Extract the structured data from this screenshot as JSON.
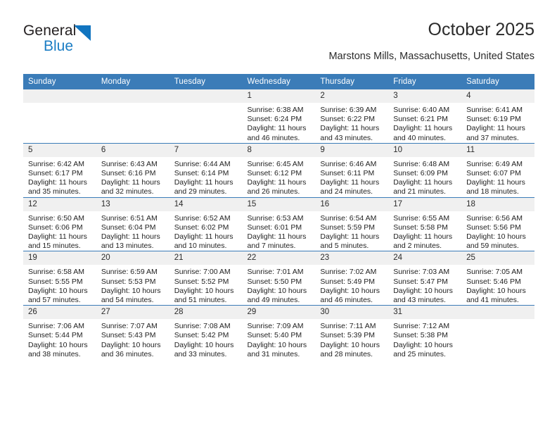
{
  "brand": {
    "name_top": "General",
    "name_bottom": "Blue",
    "accent_color": "#1b7dc4",
    "triangle_color": "#1175c0"
  },
  "header": {
    "title": "October 2025",
    "subtitle": "Marstons Mills, Massachusetts, United States",
    "header_bg": "#3b7cb8",
    "daynum_bg": "#f0f0f0"
  },
  "calendar": {
    "weekday_headers": [
      "Sunday",
      "Monday",
      "Tuesday",
      "Wednesday",
      "Thursday",
      "Friday",
      "Saturday"
    ],
    "weeks": [
      [
        {
          "day": "",
          "empty": true,
          "sunrise": "",
          "sunset": "",
          "daylight_line1": "",
          "daylight_line2": ""
        },
        {
          "day": "",
          "empty": true,
          "sunrise": "",
          "sunset": "",
          "daylight_line1": "",
          "daylight_line2": ""
        },
        {
          "day": "",
          "empty": true,
          "sunrise": "",
          "sunset": "",
          "daylight_line1": "",
          "daylight_line2": ""
        },
        {
          "day": "1",
          "empty": false,
          "sunrise": "Sunrise: 6:38 AM",
          "sunset": "Sunset: 6:24 PM",
          "daylight_line1": "Daylight: 11 hours",
          "daylight_line2": "and 46 minutes."
        },
        {
          "day": "2",
          "empty": false,
          "sunrise": "Sunrise: 6:39 AM",
          "sunset": "Sunset: 6:22 PM",
          "daylight_line1": "Daylight: 11 hours",
          "daylight_line2": "and 43 minutes."
        },
        {
          "day": "3",
          "empty": false,
          "sunrise": "Sunrise: 6:40 AM",
          "sunset": "Sunset: 6:21 PM",
          "daylight_line1": "Daylight: 11 hours",
          "daylight_line2": "and 40 minutes."
        },
        {
          "day": "4",
          "empty": false,
          "sunrise": "Sunrise: 6:41 AM",
          "sunset": "Sunset: 6:19 PM",
          "daylight_line1": "Daylight: 11 hours",
          "daylight_line2": "and 37 minutes."
        }
      ],
      [
        {
          "day": "5",
          "empty": false,
          "sunrise": "Sunrise: 6:42 AM",
          "sunset": "Sunset: 6:17 PM",
          "daylight_line1": "Daylight: 11 hours",
          "daylight_line2": "and 35 minutes."
        },
        {
          "day": "6",
          "empty": false,
          "sunrise": "Sunrise: 6:43 AM",
          "sunset": "Sunset: 6:16 PM",
          "daylight_line1": "Daylight: 11 hours",
          "daylight_line2": "and 32 minutes."
        },
        {
          "day": "7",
          "empty": false,
          "sunrise": "Sunrise: 6:44 AM",
          "sunset": "Sunset: 6:14 PM",
          "daylight_line1": "Daylight: 11 hours",
          "daylight_line2": "and 29 minutes."
        },
        {
          "day": "8",
          "empty": false,
          "sunrise": "Sunrise: 6:45 AM",
          "sunset": "Sunset: 6:12 PM",
          "daylight_line1": "Daylight: 11 hours",
          "daylight_line2": "and 26 minutes."
        },
        {
          "day": "9",
          "empty": false,
          "sunrise": "Sunrise: 6:46 AM",
          "sunset": "Sunset: 6:11 PM",
          "daylight_line1": "Daylight: 11 hours",
          "daylight_line2": "and 24 minutes."
        },
        {
          "day": "10",
          "empty": false,
          "sunrise": "Sunrise: 6:48 AM",
          "sunset": "Sunset: 6:09 PM",
          "daylight_line1": "Daylight: 11 hours",
          "daylight_line2": "and 21 minutes."
        },
        {
          "day": "11",
          "empty": false,
          "sunrise": "Sunrise: 6:49 AM",
          "sunset": "Sunset: 6:07 PM",
          "daylight_line1": "Daylight: 11 hours",
          "daylight_line2": "and 18 minutes."
        }
      ],
      [
        {
          "day": "12",
          "empty": false,
          "sunrise": "Sunrise: 6:50 AM",
          "sunset": "Sunset: 6:06 PM",
          "daylight_line1": "Daylight: 11 hours",
          "daylight_line2": "and 15 minutes."
        },
        {
          "day": "13",
          "empty": false,
          "sunrise": "Sunrise: 6:51 AM",
          "sunset": "Sunset: 6:04 PM",
          "daylight_line1": "Daylight: 11 hours",
          "daylight_line2": "and 13 minutes."
        },
        {
          "day": "14",
          "empty": false,
          "sunrise": "Sunrise: 6:52 AM",
          "sunset": "Sunset: 6:02 PM",
          "daylight_line1": "Daylight: 11 hours",
          "daylight_line2": "and 10 minutes."
        },
        {
          "day": "15",
          "empty": false,
          "sunrise": "Sunrise: 6:53 AM",
          "sunset": "Sunset: 6:01 PM",
          "daylight_line1": "Daylight: 11 hours",
          "daylight_line2": "and 7 minutes."
        },
        {
          "day": "16",
          "empty": false,
          "sunrise": "Sunrise: 6:54 AM",
          "sunset": "Sunset: 5:59 PM",
          "daylight_line1": "Daylight: 11 hours",
          "daylight_line2": "and 5 minutes."
        },
        {
          "day": "17",
          "empty": false,
          "sunrise": "Sunrise: 6:55 AM",
          "sunset": "Sunset: 5:58 PM",
          "daylight_line1": "Daylight: 11 hours",
          "daylight_line2": "and 2 minutes."
        },
        {
          "day": "18",
          "empty": false,
          "sunrise": "Sunrise: 6:56 AM",
          "sunset": "Sunset: 5:56 PM",
          "daylight_line1": "Daylight: 10 hours",
          "daylight_line2": "and 59 minutes."
        }
      ],
      [
        {
          "day": "19",
          "empty": false,
          "sunrise": "Sunrise: 6:58 AM",
          "sunset": "Sunset: 5:55 PM",
          "daylight_line1": "Daylight: 10 hours",
          "daylight_line2": "and 57 minutes."
        },
        {
          "day": "20",
          "empty": false,
          "sunrise": "Sunrise: 6:59 AM",
          "sunset": "Sunset: 5:53 PM",
          "daylight_line1": "Daylight: 10 hours",
          "daylight_line2": "and 54 minutes."
        },
        {
          "day": "21",
          "empty": false,
          "sunrise": "Sunrise: 7:00 AM",
          "sunset": "Sunset: 5:52 PM",
          "daylight_line1": "Daylight: 10 hours",
          "daylight_line2": "and 51 minutes."
        },
        {
          "day": "22",
          "empty": false,
          "sunrise": "Sunrise: 7:01 AM",
          "sunset": "Sunset: 5:50 PM",
          "daylight_line1": "Daylight: 10 hours",
          "daylight_line2": "and 49 minutes."
        },
        {
          "day": "23",
          "empty": false,
          "sunrise": "Sunrise: 7:02 AM",
          "sunset": "Sunset: 5:49 PM",
          "daylight_line1": "Daylight: 10 hours",
          "daylight_line2": "and 46 minutes."
        },
        {
          "day": "24",
          "empty": false,
          "sunrise": "Sunrise: 7:03 AM",
          "sunset": "Sunset: 5:47 PM",
          "daylight_line1": "Daylight: 10 hours",
          "daylight_line2": "and 43 minutes."
        },
        {
          "day": "25",
          "empty": false,
          "sunrise": "Sunrise: 7:05 AM",
          "sunset": "Sunset: 5:46 PM",
          "daylight_line1": "Daylight: 10 hours",
          "daylight_line2": "and 41 minutes."
        }
      ],
      [
        {
          "day": "26",
          "empty": false,
          "sunrise": "Sunrise: 7:06 AM",
          "sunset": "Sunset: 5:44 PM",
          "daylight_line1": "Daylight: 10 hours",
          "daylight_line2": "and 38 minutes."
        },
        {
          "day": "27",
          "empty": false,
          "sunrise": "Sunrise: 7:07 AM",
          "sunset": "Sunset: 5:43 PM",
          "daylight_line1": "Daylight: 10 hours",
          "daylight_line2": "and 36 minutes."
        },
        {
          "day": "28",
          "empty": false,
          "sunrise": "Sunrise: 7:08 AM",
          "sunset": "Sunset: 5:42 PM",
          "daylight_line1": "Daylight: 10 hours",
          "daylight_line2": "and 33 minutes."
        },
        {
          "day": "29",
          "empty": false,
          "sunrise": "Sunrise: 7:09 AM",
          "sunset": "Sunset: 5:40 PM",
          "daylight_line1": "Daylight: 10 hours",
          "daylight_line2": "and 31 minutes."
        },
        {
          "day": "30",
          "empty": false,
          "sunrise": "Sunrise: 7:11 AM",
          "sunset": "Sunset: 5:39 PM",
          "daylight_line1": "Daylight: 10 hours",
          "daylight_line2": "and 28 minutes."
        },
        {
          "day": "31",
          "empty": false,
          "sunrise": "Sunrise: 7:12 AM",
          "sunset": "Sunset: 5:38 PM",
          "daylight_line1": "Daylight: 10 hours",
          "daylight_line2": "and 25 minutes."
        },
        {
          "day": "",
          "empty": true,
          "sunrise": "",
          "sunset": "",
          "daylight_line1": "",
          "daylight_line2": ""
        }
      ]
    ]
  }
}
